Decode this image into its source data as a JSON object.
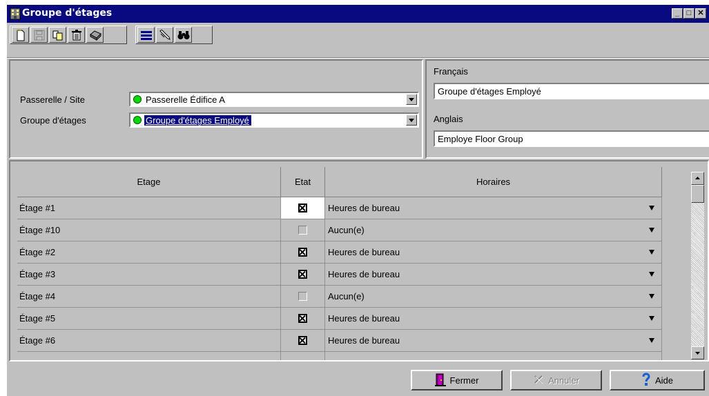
{
  "window": {
    "title": "Groupe d'étages"
  },
  "window_controls": {
    "minimize": "_",
    "maximize": "□",
    "close": "✕"
  },
  "toolbar": {
    "buttons": [
      "new-icon",
      "save-icon",
      "copy-icon",
      "delete-icon",
      "print-icon",
      "list-icon",
      "edit-icon",
      "find-icon"
    ]
  },
  "form": {
    "site_label": "Passerelle / Site",
    "site_value": "Passerelle Édifice A",
    "group_label": "Groupe d'étages",
    "group_value": "Groupe d'étages Employé",
    "francais_label": "Français",
    "francais_value": "Groupe d'étages Employé",
    "anglais_label": "Anglais",
    "anglais_value": "Employe Floor Group"
  },
  "grid": {
    "headers": {
      "etage": "Etage",
      "etat": "Etat",
      "horaires": "Horaires"
    },
    "rows": [
      {
        "etage": "Étage #1",
        "checked": true,
        "horaire": "Heures de bureau"
      },
      {
        "etage": "Étage #10",
        "checked": false,
        "horaire": "Aucun(e)"
      },
      {
        "etage": "Étage #2",
        "checked": true,
        "horaire": "Heures de bureau"
      },
      {
        "etage": "Étage #3",
        "checked": true,
        "horaire": "Heures de bureau"
      },
      {
        "etage": "Étage #4",
        "checked": false,
        "horaire": "Aucun(e)"
      },
      {
        "etage": "Étage #5",
        "checked": true,
        "horaire": "Heures de bureau"
      },
      {
        "etage": "Étage #6",
        "checked": true,
        "horaire": "Heures de bureau"
      }
    ]
  },
  "buttons": {
    "fermer": "Fermer",
    "annuler": "Annuler",
    "aide": "Aide"
  },
  "colors": {
    "titlebar": "#0a0a80",
    "face": "#c0c0c0",
    "status_dot": "#00d800"
  }
}
